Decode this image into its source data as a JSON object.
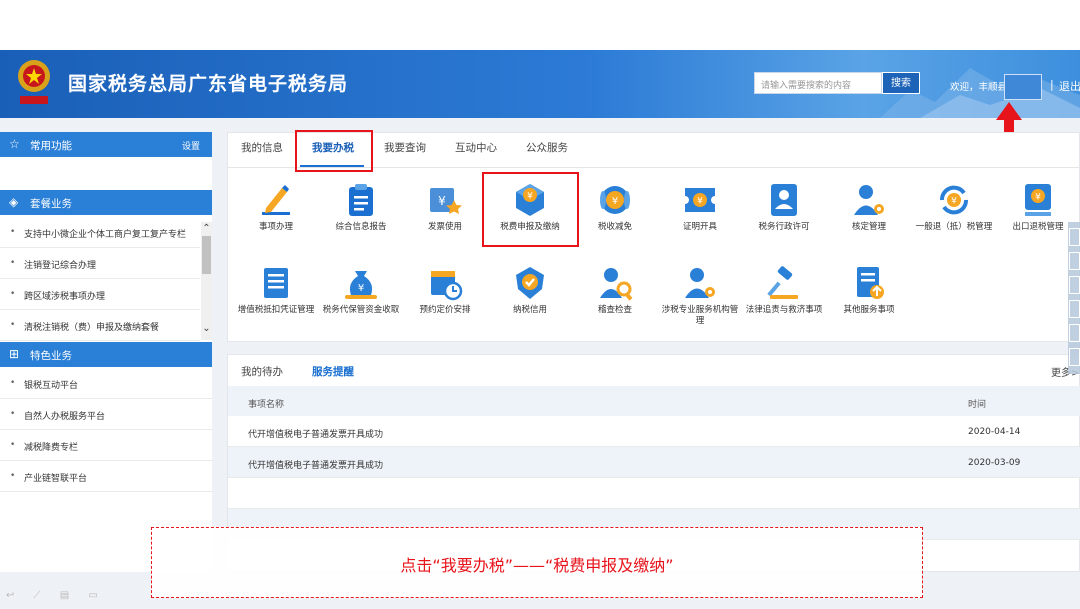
{
  "header": {
    "title": "国家税务总局广东省电子税务局",
    "search_placeholder": "请输入需要搜索的内容",
    "search_button": "搜索",
    "welcome": "欢迎，丰顺县",
    "separator": "|",
    "logout": "退出"
  },
  "sidebar": {
    "common": {
      "label": "常用功能",
      "setting": "设置"
    },
    "package": {
      "label": "套餐业务",
      "items": [
        "支持中小微企业个体工商户复工复产专栏",
        "注销登记综合办理",
        "跨区域涉税事项办理",
        "清税注销税（费）申报及缴纳套餐"
      ]
    },
    "special": {
      "label": "特色业务",
      "items": [
        "银税互动平台",
        "自然人办税服务平台",
        "减税降费专栏",
        "产业链智联平台"
      ]
    }
  },
  "tabs": [
    "我的信息",
    "我要办税",
    "我要查询",
    "互动中心",
    "公众服务"
  ],
  "functions": [
    {
      "label": "事项办理",
      "icon": "pencil-icon"
    },
    {
      "label": "综合信息报告",
      "icon": "clipboard-icon"
    },
    {
      "label": "发票使用",
      "icon": "invoice-icon"
    },
    {
      "label": "税费申报及缴纳",
      "icon": "tax-declare-icon"
    },
    {
      "label": "税收减免",
      "icon": "coins-icon"
    },
    {
      "label": "证明开具",
      "icon": "ticket-icon"
    },
    {
      "label": "税务行政许可",
      "icon": "id-card-icon"
    },
    {
      "label": "核定管理",
      "icon": "user-gear-icon"
    },
    {
      "label": "一般退（抵）税管理",
      "icon": "refund-cycle-icon"
    },
    {
      "label": "出口退税管理",
      "icon": "export-icon"
    },
    {
      "label": "增值税抵扣凭证管理",
      "icon": "receipt-icon"
    },
    {
      "label": "税务代保管资金收取",
      "icon": "money-bag-icon"
    },
    {
      "label": "预约定价安排",
      "icon": "calendar-clock-icon"
    },
    {
      "label": "纳税信用",
      "icon": "credit-badge-icon"
    },
    {
      "label": "稽查检查",
      "icon": "inspect-icon"
    },
    {
      "label": "涉税专业服务机构管理",
      "icon": "agent-gear-icon"
    },
    {
      "label": "法律追责与救济事项",
      "icon": "gavel-icon"
    },
    {
      "label": "其他服务事项",
      "icon": "doc-upload-icon"
    }
  ],
  "reminders": {
    "tabs": [
      "我的待办",
      "服务提醒"
    ],
    "more": "更多>",
    "columns": [
      "事项名称",
      "时间"
    ],
    "rows": [
      {
        "name": "代开增值税电子普通发票开具成功",
        "time": "2020-04-14"
      },
      {
        "name": "代开增值税电子普通发票开具成功",
        "time": "2020-03-09"
      }
    ]
  },
  "annotation": "点击“我要办税”——“税费申报及缴纳”",
  "colors": {
    "brand_blue": "#1a5fb7",
    "highlight_red": "#e8141c"
  }
}
